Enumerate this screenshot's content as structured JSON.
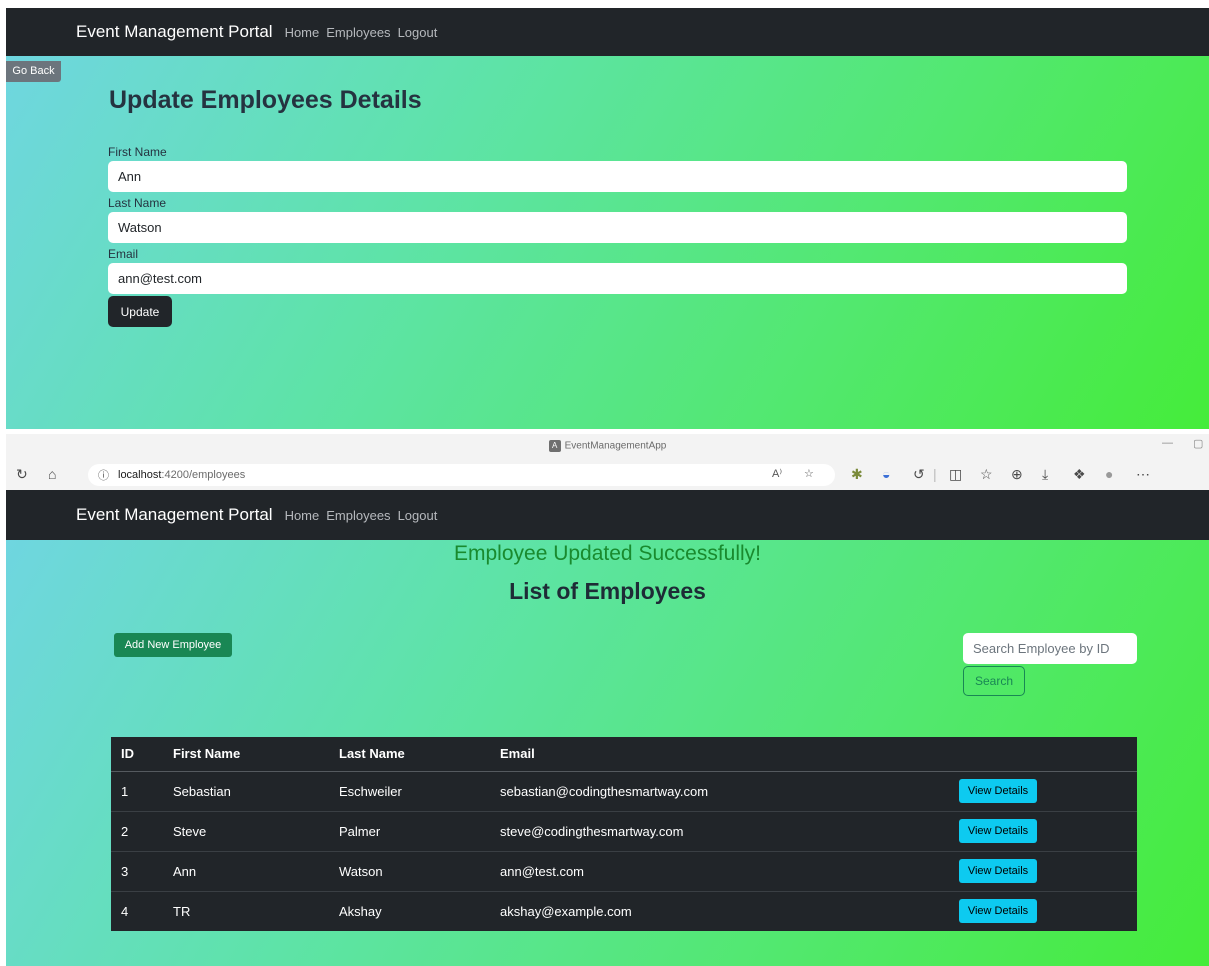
{
  "app": {
    "brand": "Event Management Portal",
    "nav": [
      "Home",
      "Employees",
      "Logout"
    ]
  },
  "update_page": {
    "go_back_label": "Go Back",
    "title": "Update Employees Details",
    "fields": [
      {
        "label": "First Name",
        "value": "Ann"
      },
      {
        "label": "Last Name",
        "value": "Watson"
      },
      {
        "label": "Email",
        "value": "ann@test.com"
      }
    ],
    "update_button": "Update"
  },
  "browser": {
    "window_title": "EventManagementApp",
    "url_host": "localhost",
    "url_path": ":4200/employees",
    "icons": [
      "refresh-icon",
      "home-icon",
      "info-icon",
      "read-aloud-icon",
      "favorite-star-icon",
      "extension-icon",
      "extension-icon",
      "copilot-icon",
      "split-screen-icon",
      "favorites-icon",
      "collections-icon",
      "download-icon",
      "extension-icon",
      "profile-icon",
      "more-icon"
    ]
  },
  "list_page": {
    "success_message": "Employee Updated Successfully!",
    "title": "List of Employees",
    "add_button": "Add New Employee",
    "search_placeholder": "Search Employee by ID",
    "search_button": "Search",
    "table": {
      "headers": [
        "ID",
        "First Name",
        "Last Name",
        "Email",
        ""
      ],
      "rows": [
        {
          "id": "1",
          "first": "Sebastian",
          "last": "Eschweiler",
          "email": "sebastian@codingthesmartway.com",
          "action": "View Details"
        },
        {
          "id": "2",
          "first": "Steve",
          "last": "Palmer",
          "email": "steve@codingthesmartway.com",
          "action": "View Details"
        },
        {
          "id": "3",
          "first": "Ann",
          "last": "Watson",
          "email": "ann@test.com",
          "action": "View Details"
        },
        {
          "id": "4",
          "first": "TR",
          "last": "Akshay",
          "email": "akshay@example.com",
          "action": "View Details"
        }
      ]
    }
  },
  "colors": {
    "navbar": "#212529",
    "gradient_start": "#6fd6e0",
    "gradient_end": "#45ec3a",
    "success_text": "#198a2e",
    "add_button": "#198754",
    "view_button": "#0dcaf0"
  }
}
